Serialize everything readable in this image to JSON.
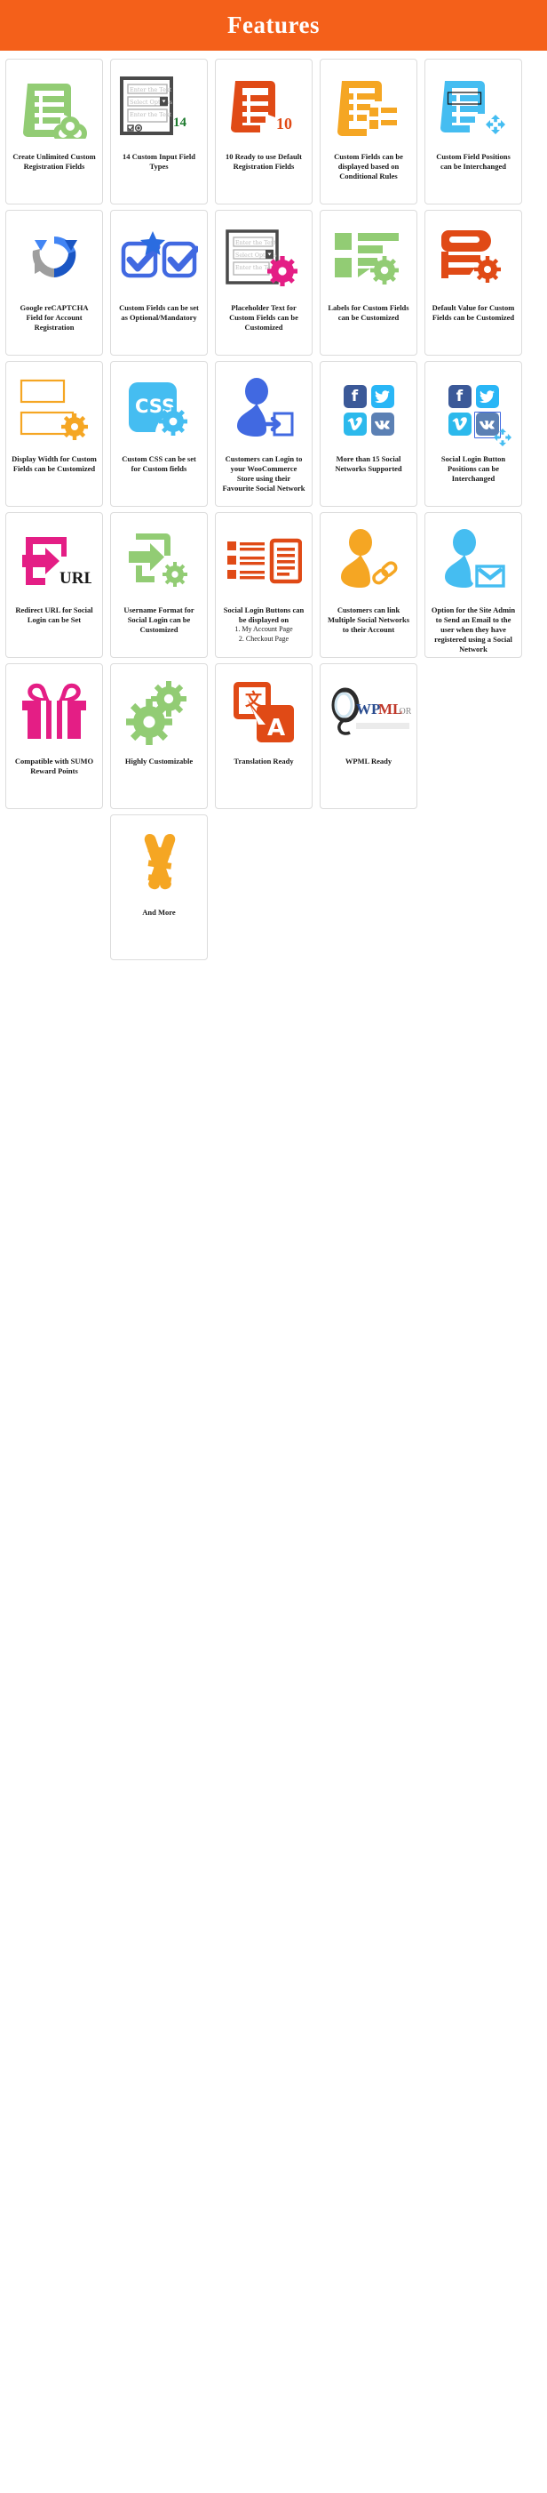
{
  "header": {
    "title": "Features"
  },
  "colors": {
    "header_bg": "#f4601a",
    "green": "#92cc74",
    "orange_dark": "#e04a16",
    "orange": "#f5a623",
    "blue": "#45bdf1",
    "blue_dark": "#4169e1",
    "pink": "#e41e85",
    "gray": "#9b9b9b"
  },
  "cards": [
    {
      "id": "create-unlimited-custom-registration-fields",
      "icon": "list-infinity-icon",
      "caption": "Create Unlimited Custom Registration Fields"
    },
    {
      "id": "custom-input-field-types",
      "icon": "form-mockup-icon",
      "badge": "14",
      "caption": "14 Custom Input Field Types"
    },
    {
      "id": "ready-to-use-default-registration-fields",
      "icon": "list-document-icon",
      "badge": "10",
      "caption": "10 Ready to use Default Registration Fields"
    },
    {
      "id": "custom-fields-conditional-rules",
      "icon": "list-sublist-icon",
      "caption": "Custom Fields can be displayed based on Conditional Rules"
    },
    {
      "id": "custom-field-positions-interchanged",
      "icon": "list-move-icon",
      "caption": "Custom Field Positions can be Interchanged"
    },
    {
      "id": "google-recaptcha-field",
      "icon": "recaptcha-icon",
      "caption": "Google reCAPTCHA Field for Account Registration"
    },
    {
      "id": "custom-fields-optional-mandatory",
      "icon": "checkbox-star-icon",
      "caption": "Custom Fields can be set as Optional/Mandatory"
    },
    {
      "id": "placeholder-text-customized",
      "icon": "form-gear-icon",
      "caption": "Placeholder Text for Custom Fields can be Customized"
    },
    {
      "id": "labels-customized",
      "icon": "labels-gear-icon",
      "caption": "Labels for Custom Fields can be Customized"
    },
    {
      "id": "default-value-customized",
      "icon": "default-value-gear-icon",
      "caption": "Default Value for Custom Fields can be Customized"
    },
    {
      "id": "display-width-customized",
      "icon": "width-boxes-gear-icon",
      "caption": "Display Width for Custom Fields can be Customized"
    },
    {
      "id": "custom-css",
      "icon": "css-gear-icon",
      "caption": "Custom CSS can be set for Custom fields"
    },
    {
      "id": "customers-social-login",
      "icon": "user-login-icon",
      "caption": "Customers can Login to your WooCommerce Store using their Favourite Social Network"
    },
    {
      "id": "social-networks-supported",
      "icon": "social-networks-icon",
      "caption": "More than 15 Social Networks Supported"
    },
    {
      "id": "social-login-button-positions",
      "icon": "social-networks-move-icon",
      "caption": "Social Login Button Positions can be Interchanged"
    },
    {
      "id": "redirect-url-social-login",
      "icon": "redirect-url-icon",
      "caption": "Redirect URL for Social Login can be Set"
    },
    {
      "id": "username-format-social-login",
      "icon": "username-format-gear-icon",
      "caption": "Username Format for Social Login can be Customized"
    },
    {
      "id": "social-login-buttons-display",
      "icon": "list-pages-icon",
      "caption": "Social Login Buttons can be displayed on",
      "sublist": [
        "1. My Account Page",
        "2. Checkout Page"
      ]
    },
    {
      "id": "link-multiple-social-networks",
      "icon": "user-link-icon",
      "caption": "Customers can link Multiple Social Networks to their Account"
    },
    {
      "id": "admin-email-option",
      "icon": "user-email-icon",
      "caption": "Option for the Site Admin to Send an Email to the user when they have registered using a Social Network"
    },
    {
      "id": "sumo-reward-points-compatible",
      "icon": "gift-icon",
      "caption": "Compatible with SUMO Reward Points"
    },
    {
      "id": "highly-customizable",
      "icon": "gears-icon",
      "caption": "Highly Customizable"
    },
    {
      "id": "translation-ready",
      "icon": "translate-icon",
      "caption": "Translation Ready"
    },
    {
      "id": "wpml-ready",
      "icon": "wpml-logo-icon",
      "logo_text": "WPML.ORG",
      "caption": "WPML Ready"
    },
    {
      "id": "and-more",
      "icon": "ladder-icon",
      "caption": "And More"
    }
  ],
  "form_mockup": {
    "field1": "Enter the Text",
    "field2": "Select Options",
    "field3": "Enter the Text"
  },
  "css_badge": {
    "text": "CSS"
  },
  "url_badge": {
    "text": "URL"
  }
}
